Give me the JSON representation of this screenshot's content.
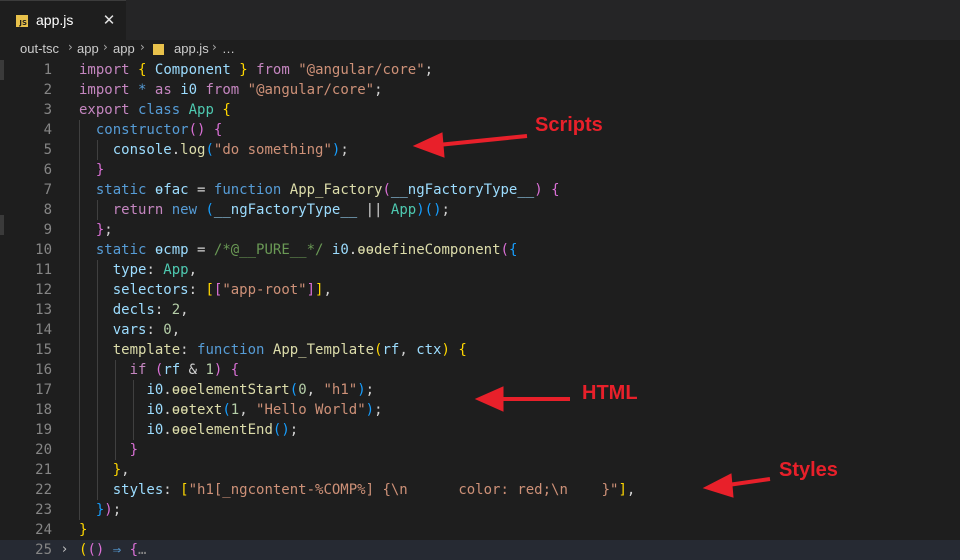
{
  "tab": {
    "label": "app.js",
    "badge": "JS",
    "close": "✕"
  },
  "breadcrumb": [
    "out-tsc",
    "app",
    "app",
    "app.js",
    "…"
  ],
  "line_numbers": [
    "1",
    "2",
    "3",
    "4",
    "5",
    "6",
    "7",
    "8",
    "9",
    "10",
    "11",
    "12",
    "13",
    "14",
    "15",
    "16",
    "17",
    "18",
    "19",
    "20",
    "21",
    "22",
    "23",
    "24",
    "25"
  ],
  "annotations": {
    "scripts": "Scripts",
    "html": "HTML",
    "styles": "Styles"
  },
  "colors": {
    "annotation": "#e8202a",
    "keyword": "#c586c0",
    "storage": "#569cd6",
    "function": "#dcdcaa",
    "string": "#ce9178"
  }
}
